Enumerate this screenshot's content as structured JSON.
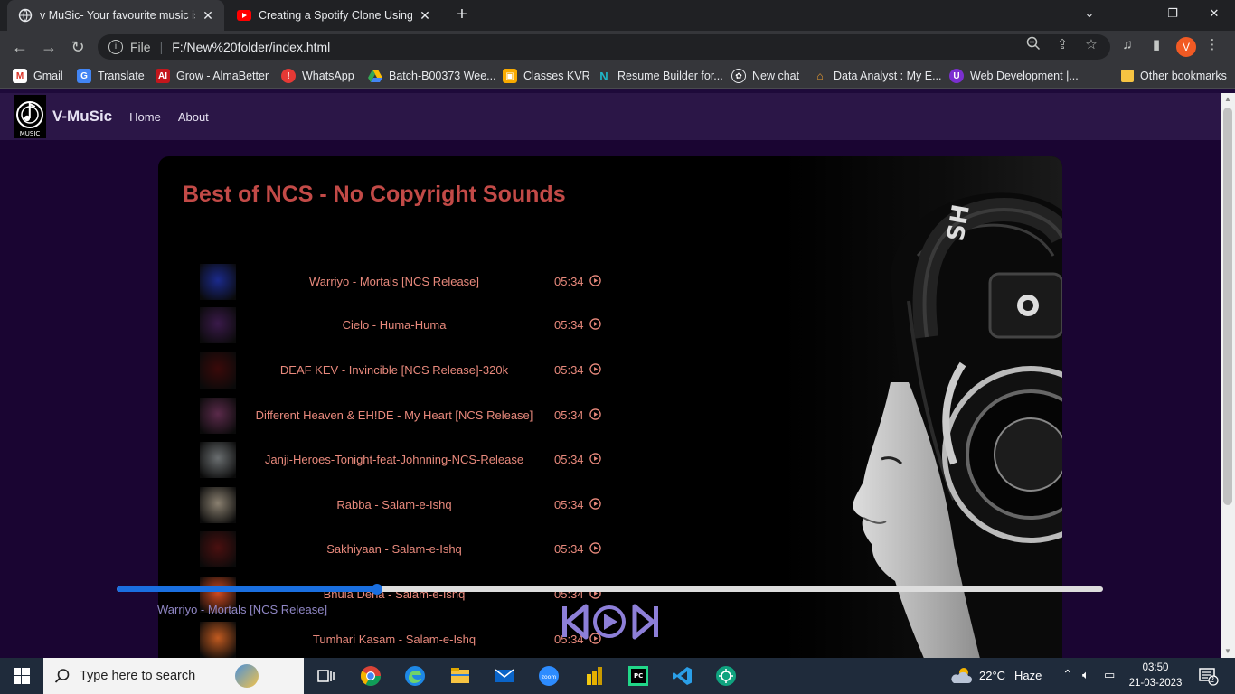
{
  "browser": {
    "tabs": [
      {
        "title": "v MuSic- Your favourite music is here",
        "active": true
      },
      {
        "title": "Creating a Spotify Clone Using HTML",
        "active": false
      }
    ],
    "url_scheme": "File",
    "url": "F:/New%20folder/index.html",
    "profile_initial": "V",
    "bookmarks": [
      "Gmail",
      "Translate",
      "Grow - AlmaBetter",
      "WhatsApp",
      "Batch-B00373 Wee...",
      "Classes KVR",
      "Resume Builder for...",
      "New chat",
      "Data Analyst : My E...",
      "Web Development |..."
    ],
    "other_bookmarks": "Other bookmarks"
  },
  "site": {
    "brand": "V-MuSic",
    "logo_text": "MUSIC",
    "nav": [
      "Home",
      "About"
    ],
    "heading": "Best of NCS - No Copyright Sounds"
  },
  "songs": [
    {
      "name": "Warriyo - Mortals [NCS Release]",
      "time": "05:34",
      "art": "#1b2a8c"
    },
    {
      "name": "Cielo - Huma-Huma",
      "time": "05:34",
      "art": "#3a1a4a"
    },
    {
      "name": "DEAF KEV - Invincible [NCS Release]-320k",
      "time": "05:34",
      "art": "#3a0a0a"
    },
    {
      "name": "Different Heaven & EH!DE - My Heart [NCS Release]",
      "time": "05:34",
      "art": "#5a2a4a"
    },
    {
      "name": "Janji-Heroes-Tonight-feat-Johnning-NCS-Release",
      "time": "05:34",
      "art": "#6a6e70"
    },
    {
      "name": "Rabba - Salam-e-Ishq",
      "time": "05:34",
      "art": "#8a8070"
    },
    {
      "name": "Sakhiyaan - Salam-e-Ishq",
      "time": "05:34",
      "art": "#4a1010"
    },
    {
      "name": "Bhula Dena - Salam-e-Ishq",
      "time": "05:34",
      "art": "#d04a20"
    },
    {
      "name": "Tumhari Kasam - Salam-e-Ishq",
      "time": "05:34",
      "art": "#c05a20"
    }
  ],
  "player": {
    "now_playing": "Warriyo - Mortals [NCS Release]",
    "progress": 0.264
  },
  "taskbar": {
    "search_placeholder": "Type here to search",
    "weather": "22°C",
    "weather_desc": "Haze",
    "time": "03:50",
    "date": "21-03-2023",
    "notifications": "2"
  },
  "colors": {
    "accent": "#c24a47",
    "song_text": "#e8897c",
    "progress": "#1a6fe0"
  }
}
